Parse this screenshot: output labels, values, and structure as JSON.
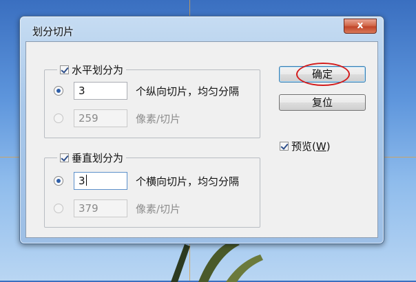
{
  "dialog": {
    "title": "划分切片",
    "close_glyph": "x"
  },
  "horizontal": {
    "checkbox_label": "水平划分为",
    "checked": true,
    "count_value": "3",
    "count_suffix": "个纵向切片，均匀分隔",
    "pixels_value": "259",
    "pixels_suffix": "像素/切片"
  },
  "vertical": {
    "checkbox_label": "垂直划分为",
    "checked": true,
    "count_value": "3",
    "count_suffix": "个横向切片，均匀分隔",
    "pixels_value": "379",
    "pixels_suffix": "像素/切片"
  },
  "buttons": {
    "ok": "确定",
    "reset": "复位"
  },
  "preview": {
    "label_prefix": "预览(",
    "mnemonic": "W",
    "label_suffix": ")",
    "checked": true
  },
  "colors": {
    "highlight": "#d31b1b",
    "radio_selected": "#2f5fa8"
  }
}
